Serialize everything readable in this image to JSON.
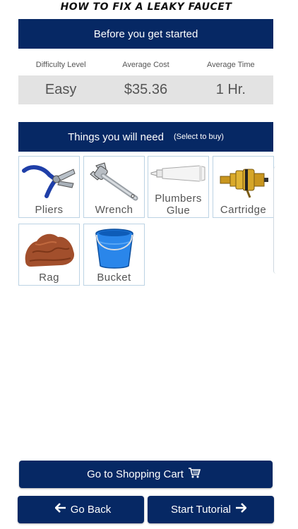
{
  "header": {
    "title": "HOW TO FIX A LEAKY FAUCET"
  },
  "intro": {
    "banner": "Before you get started",
    "labels": {
      "difficulty": "Difficulty Level",
      "cost": "Average Cost",
      "time": "Average Time"
    },
    "values": {
      "difficulty": "Easy",
      "cost": "$35.36",
      "time": "1 Hr."
    }
  },
  "needs": {
    "banner": "Things you will need",
    "hint": "(Select to buy)",
    "items": [
      {
        "label": "Pliers",
        "icon": "pliers-icon"
      },
      {
        "label": "Wrench",
        "icon": "wrench-icon"
      },
      {
        "label_line1": "Plumbers",
        "label_line2": "Glue",
        "icon": "glue-tube-icon"
      },
      {
        "label": "Cartridge",
        "icon": "cartridge-icon"
      },
      {
        "label": "Rag",
        "icon": "rag-icon"
      },
      {
        "label": "Bucket",
        "icon": "bucket-icon"
      }
    ]
  },
  "footer": {
    "cart": "Go to Shopping Cart",
    "back": "Go Back",
    "start": "Start Tutorial"
  },
  "colors": {
    "navy": "#062864",
    "panel": "#e3e3e3",
    "tile_border": "#bcd3e4"
  }
}
